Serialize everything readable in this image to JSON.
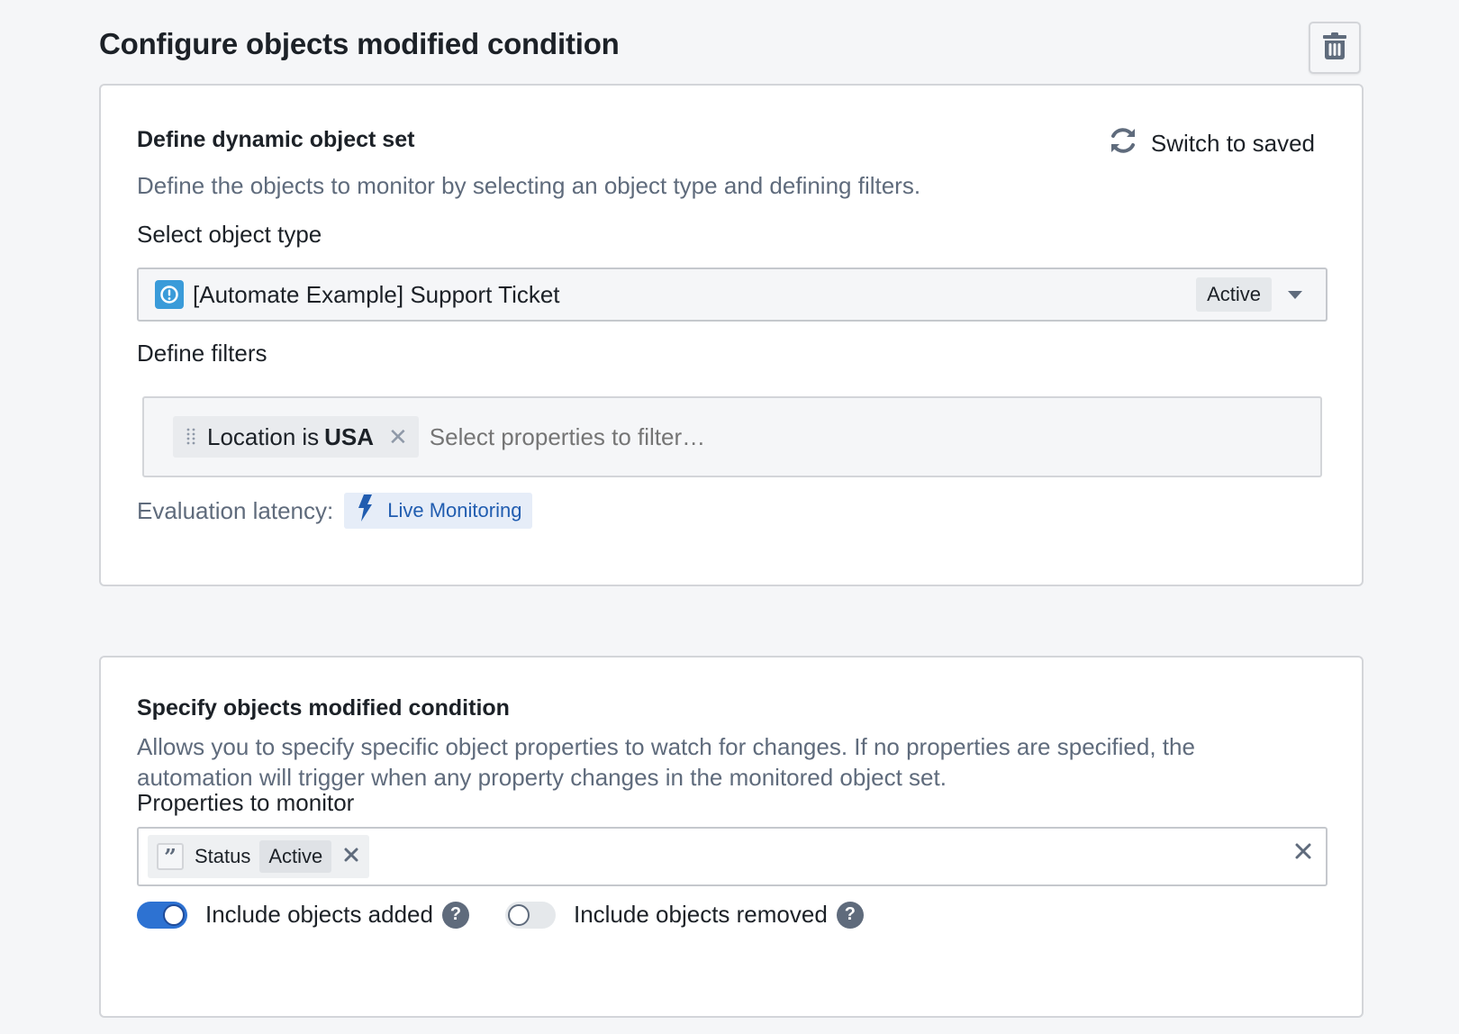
{
  "header": {
    "title": "Configure objects modified condition",
    "delete_icon": "trash-icon"
  },
  "object_set": {
    "title": "Define dynamic object set",
    "switch_label": "Switch to saved",
    "switch_icon": "refresh-icon",
    "description": "Define the objects to monitor by selecting an object type and defining filters.",
    "object_type_label": "Select object type",
    "object_type": {
      "icon": "object-type-info-icon",
      "value": "[Automate Example] Support Ticket",
      "status": "Active"
    },
    "filters_label": "Define filters",
    "filters": [
      {
        "property": "Location",
        "operator": "is",
        "value": "USA"
      }
    ],
    "filter_placeholder": "Select properties to filter…",
    "latency_label": "Evaluation latency:",
    "latency_value": "Live Monitoring",
    "latency_icon": "lightning-icon"
  },
  "condition": {
    "title": "Specify objects modified condition",
    "description_line1": "Allows you to specify specific object properties to watch for changes. If no properties are specified, the",
    "description_line2": "automation will trigger when any property changes in the monitored object set.",
    "properties_label": "Properties to monitor",
    "properties": [
      {
        "icon": "quote-icon",
        "name": "Status",
        "tag": "Active"
      }
    ],
    "toggles": [
      {
        "label": "Include objects added",
        "on": true
      },
      {
        "label": "Include objects removed",
        "on": false
      }
    ]
  },
  "colors": {
    "accent": "#2d72d2",
    "live_tag_bg": "#e6edf8",
    "live_tag_text": "#215db0",
    "object_icon": "#3a9bd9",
    "muted_text": "#5f6b7c"
  }
}
